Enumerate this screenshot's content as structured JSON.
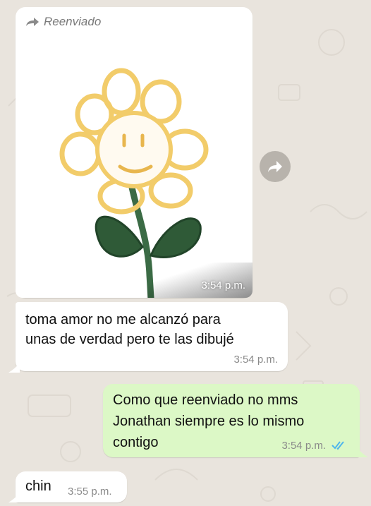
{
  "messages": [
    {
      "forwarded_label": "Reenviado",
      "image_time": "3:54 p.m.",
      "text_line1": "toma amor no me alcanzó para",
      "text_line2": "unas de verdad pero te las dibujé",
      "time": "3:54 p.m."
    },
    {
      "text_line1": "Como que reenviado no mms",
      "text_line2": "Jonathan siempre es lo mismo",
      "text_line3": "contigo",
      "time": "3:54 p.m.",
      "status": "read"
    },
    {
      "text": "chin",
      "time": "3:55 p.m."
    }
  ],
  "colors": {
    "incoming_bubble": "#ffffff",
    "outgoing_bubble": "#dcf8c6",
    "read_ticks": "#4fb6ec",
    "background": "#e9e4dd"
  },
  "icons": {
    "forwarded": "forward-arrow-icon",
    "forward_button": "share-forward-icon",
    "read_receipt": "double-check-icon"
  }
}
